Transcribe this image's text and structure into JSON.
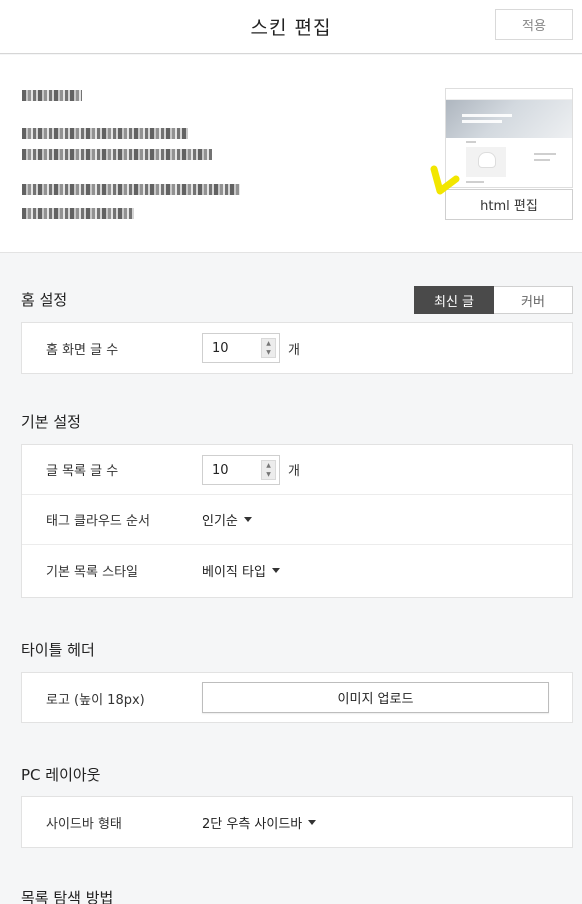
{
  "header": {
    "title": "스킨 편집",
    "apply_label": "적용"
  },
  "skin_info": {
    "html_edit_label": "html 편집"
  },
  "home_settings": {
    "title": "홈 설정",
    "segment": {
      "options": [
        "최신 글",
        "커버"
      ],
      "selected": "최신 글"
    },
    "rows": [
      {
        "label": "홈 화면 글 수",
        "value": "10",
        "unit": "개"
      }
    ]
  },
  "basic_settings": {
    "title": "기본 설정",
    "post_count": {
      "label": "글 목록 글 수",
      "value": "10",
      "unit": "개"
    },
    "tag_cloud": {
      "label": "태그 클라우드 순서",
      "value": "인기순"
    },
    "list_style": {
      "label": "기본 목록 스타일",
      "value": "베이직 타입"
    }
  },
  "title_header": {
    "title": "타이틀 헤더",
    "logo": {
      "label": "로고 (높이 18px)",
      "button": "이미지 업로드"
    }
  },
  "pc_layout": {
    "title": "PC 레이아웃",
    "sidebar": {
      "label": "사이드바 형태",
      "value": "2단 우측 사이드바"
    }
  },
  "list_nav": {
    "title": "목록 탐색 방법"
  }
}
